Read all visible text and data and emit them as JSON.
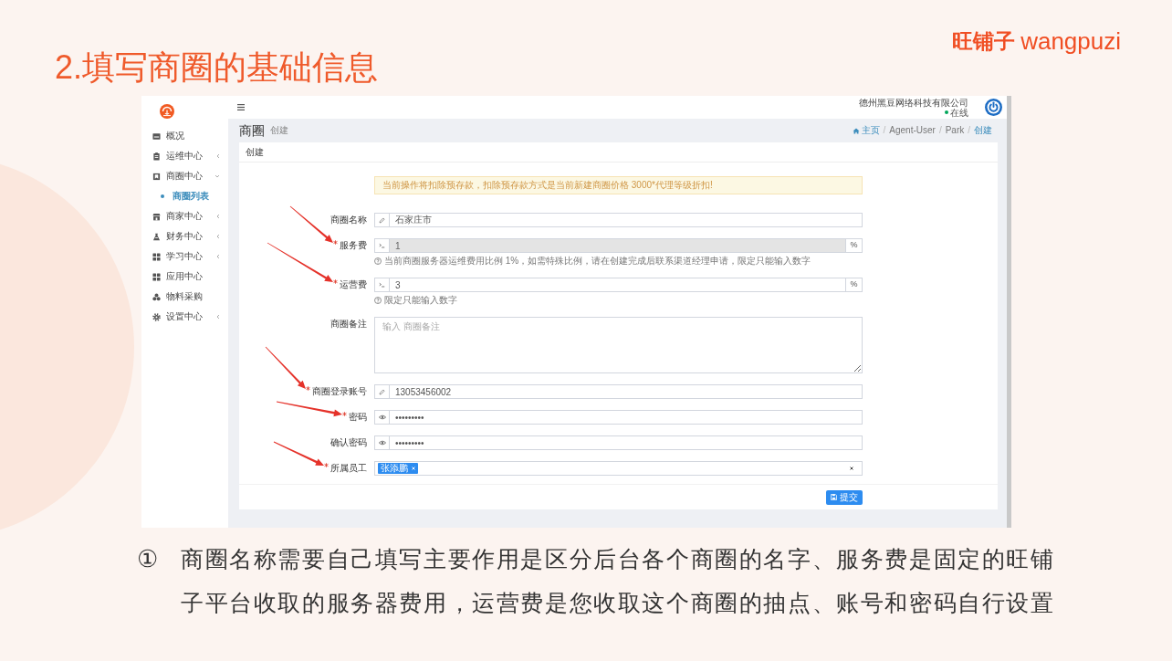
{
  "slide": {
    "title": "2.填写商圈的基础信息",
    "logo": {
      "cn": "旺铺子",
      "en": "wangpuzi"
    }
  },
  "sidebar": {
    "items": [
      {
        "label": "概况",
        "kind": "link",
        "selected": false,
        "expanded": false
      },
      {
        "label": "运维中心",
        "kind": "group",
        "selected": false,
        "expanded": false
      },
      {
        "label": "商圈中心",
        "kind": "group",
        "selected": false,
        "expanded": true,
        "children": [
          {
            "label": "商圈列表",
            "selected": true
          }
        ]
      },
      {
        "label": "商家中心",
        "kind": "group",
        "selected": false,
        "expanded": false
      },
      {
        "label": "财务中心",
        "kind": "group",
        "selected": false,
        "expanded": false
      },
      {
        "label": "学习中心",
        "kind": "group",
        "selected": false,
        "expanded": false
      },
      {
        "label": "应用中心",
        "kind": "link",
        "selected": false,
        "expanded": false
      },
      {
        "label": "物料采购",
        "kind": "link",
        "selected": false,
        "expanded": false
      },
      {
        "label": "设置中心",
        "kind": "group",
        "selected": false,
        "expanded": false
      }
    ]
  },
  "topbar": {
    "company": "德州黑豆网络科技有限公司",
    "status": "在线",
    "online": true
  },
  "page_header": {
    "title": "商圈",
    "subtitle": "创建"
  },
  "breadcrumb": {
    "separator": "/",
    "items": [
      {
        "label": "主页",
        "kind": "home"
      },
      {
        "label": "Agent-User",
        "kind": "plain"
      },
      {
        "label": "Park",
        "kind": "plain"
      },
      {
        "label": "创建",
        "kind": "current"
      }
    ]
  },
  "card": {
    "title": "创建",
    "alert": "当前操作将扣除预存款，扣除预存款方式是当前新建商圈价格 3000*代理等级折扣!",
    "fields": [
      {
        "label": "商圈名称",
        "required": false,
        "annotated": false,
        "disabled": false,
        "kind": "text",
        "value": "石家庄市"
      },
      {
        "label": "服务费",
        "required": true,
        "annotated": true,
        "disabled": true,
        "kind": "number",
        "value": "1",
        "suffix": "%",
        "help": "当前商圈服务器运维费用比例 1%，如需特殊比例，请在创建完成后联系渠道经理申请，限定只能输入数字"
      },
      {
        "label": "运营费",
        "required": true,
        "annotated": true,
        "disabled": false,
        "kind": "number",
        "value": "3",
        "suffix": "%",
        "help": "限定只能输入数字"
      },
      {
        "label": "商圈备注",
        "required": false,
        "annotated": false,
        "disabled": false,
        "kind": "textarea",
        "placeholder": "输入 商圈备注"
      },
      {
        "label": "商圈登录账号",
        "required": true,
        "annotated": true,
        "disabled": false,
        "kind": "text",
        "value": "13053456002"
      },
      {
        "label": "密码",
        "required": true,
        "annotated": true,
        "disabled": false,
        "kind": "password",
        "value": "•••••••••"
      },
      {
        "label": "确认密码",
        "required": false,
        "annotated": false,
        "disabled": false,
        "kind": "password",
        "value": "•••••••••"
      },
      {
        "label": "所属员工",
        "required": true,
        "annotated": true,
        "disabled": false,
        "kind": "select",
        "tags": [
          {
            "label": "张添鹏"
          }
        ]
      }
    ],
    "submit": "提交"
  },
  "caption": {
    "marker": "①",
    "text": "商圈名称需要自己填写主要作用是区分后台各个商圈的名字、服务费是固定的旺铺子平台收取的服务器费用，运营费是您收取这个商圈的抽点、账号和密码自行设置"
  }
}
